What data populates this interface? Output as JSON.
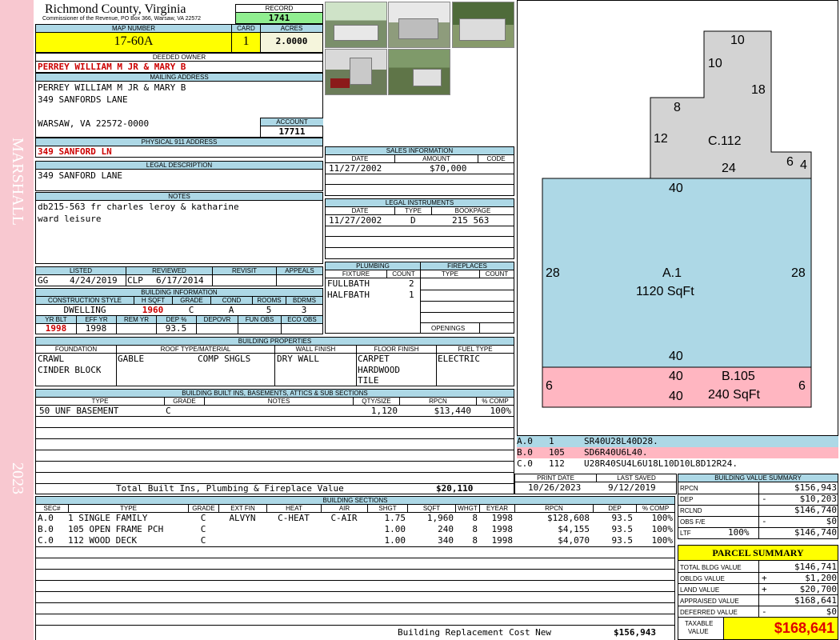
{
  "sidebar": {
    "name": "MARSHALL",
    "year": "2023"
  },
  "header": {
    "county": "Richmond County, Virginia",
    "subtitle": "Commissioner of the Revenue, PO Box 366, Warsaw, VA 22572",
    "record_label": "RECORD",
    "record": "1741",
    "map_label": "MAP NUMBER",
    "map_number": "17-60A",
    "card_label": "CARD",
    "card": "1",
    "acres_label": "ACRES",
    "acres": "2.0000"
  },
  "owner": {
    "label": "DEEDED OWNER",
    "name": "PERREY WILLIAM M JR & MARY B"
  },
  "mailing": {
    "label": "MAILING ADDRESS",
    "line1": "PERREY WILLIAM M JR & MARY B",
    "line2": "349 SANFORDS LANE",
    "line3": "WARSAW, VA 22572-0000",
    "account_label": "ACCOUNT",
    "account": "17711"
  },
  "physical": {
    "label": "PHYSICAL 911 ADDRESS",
    "address": "349 SANFORD LN"
  },
  "legal": {
    "label": "LEGAL DESCRIPTION",
    "text": "349 SANFORD LANE"
  },
  "notes": {
    "label": "NOTES",
    "line1": "db215-563 fr charles leroy & katharine",
    "line2": "ward leisure"
  },
  "status": {
    "listed_label": "LISTED",
    "reviewed_label": "REVIEWED",
    "revisit_label": "REVISIT",
    "appeals_label": "APPEALS",
    "listed_by": "GG",
    "listed_date": "4/24/2019",
    "reviewed_by": "CLP",
    "reviewed_date": "6/17/2014"
  },
  "building_info": {
    "label": "BUILDING INFORMATION",
    "h": [
      "CONSTRUCTION STYLE",
      "H SQFT",
      "GRADE",
      "COND",
      "ROOMS",
      "BDRMS"
    ],
    "v": [
      "DWELLING",
      "1960",
      "C",
      "A",
      "5",
      "3"
    ],
    "h2": [
      "YR BLT",
      "EFF YR",
      "REM YR",
      "DEP %",
      "DEPOVR",
      "FUN OBS",
      "ECO OBS"
    ],
    "v2": [
      "1998",
      "1998",
      "",
      "93.5",
      "",
      "",
      ""
    ]
  },
  "sales": {
    "label": "SALES INFORMATION",
    "h": [
      "DATE",
      "AMOUNT",
      "CODE"
    ],
    "date": "11/27/2002",
    "amount": "$70,000"
  },
  "instruments": {
    "label": "LEGAL INSTRUMENTS",
    "h": [
      "DATE",
      "TYPE",
      "BOOKPAGE"
    ],
    "date": "11/27/2002",
    "type": "D",
    "bookpage": "215 563"
  },
  "plumbing": {
    "label": "PLUMBING",
    "h": [
      "FIXTURE",
      "COUNT"
    ],
    "rows": [
      {
        "f": "FULLBATH",
        "c": "2"
      },
      {
        "f": "HALFBATH",
        "c": "1"
      }
    ]
  },
  "fireplaces": {
    "label": "FIREPLACES",
    "h": [
      "TYPE",
      "COUNT"
    ],
    "openings": "OPENINGS"
  },
  "properties": {
    "label": "BUILDING PROPERTIES",
    "h": [
      "FOUNDATION",
      "ROOF TYPE/MATERIAL",
      "WALL FINISH",
      "FLOOR FINISH",
      "FUEL TYPE"
    ],
    "foundation1": "CRAWL",
    "foundation2": "CINDER BLOCK",
    "roof_type": "GABLE",
    "roof_mat": "COMP SHGLS",
    "wall": "DRY WALL",
    "floor1": "CARPET",
    "floor2": "HARDWOOD",
    "floor3": "TILE",
    "fuel": "ELECTRIC"
  },
  "builtins": {
    "label": "BUILDING BUILT INS, BASEMENTS, ATTICS & SUB SECTIONS",
    "h": [
      "TYPE",
      "GRADE",
      "NOTES",
      "QTY/SIZE",
      "RPCN",
      "% COMP"
    ],
    "row": {
      "type": "50 UNF BASEMENT",
      "grade": "C",
      "qty": "1,120",
      "rpcn": "$13,440",
      "comp": "100%"
    },
    "total_label": "Total Built Ins, Plumbing & Fireplace Value",
    "total": "$20,110"
  },
  "dates": {
    "print_label": "PRINT DATE",
    "print": "10/26/2023",
    "saved_label": "LAST SAVED",
    "saved": "9/12/2019"
  },
  "sections": {
    "label": "BUILDING SECTIONS",
    "h": [
      "SEC#",
      "TYPE",
      "GRADE",
      "EXT FIN",
      "HEAT",
      "AIR",
      "SHGT",
      "SQFT",
      "WHGT",
      "EYEAR",
      "RPCN",
      "DEP",
      "% COMP"
    ],
    "rows": [
      [
        "A.0",
        "1 SINGLE FAMILY",
        "C",
        "ALVYN",
        "C-HEAT",
        "C-AIR",
        "1.75",
        "1,960",
        "8",
        "1998",
        "$128,608",
        "93.5",
        "100%"
      ],
      [
        "B.0",
        "105 OPEN FRAME PCH",
        "C",
        "",
        "",
        "",
        "1.00",
        "240",
        "8",
        "1998",
        "$4,155",
        "93.5",
        "100%"
      ],
      [
        "C.0",
        "112 WOOD DECK",
        "C",
        "",
        "",
        "",
        "1.00",
        "340",
        "8",
        "1998",
        "$4,070",
        "93.5",
        "100%"
      ]
    ],
    "total_label": "Building Replacement Cost New",
    "total": "$156,943"
  },
  "sketch": {
    "c_label": "C.112",
    "a_label": "A.1",
    "a_area": "1120 SqFt",
    "b_label": "B.105",
    "b_area": "240 SqFt",
    "dims": {
      "c_top": "10",
      "c_step_v": "10",
      "c_right": "18",
      "c_step_h": "8",
      "c_left": "12",
      "c_bottom": "24",
      "c_small1": "6",
      "c_small2": "4",
      "a_top": "40",
      "a_left": "28",
      "a_right": "28",
      "a_bottom": "40",
      "b_top": "40",
      "b_bottom": "40",
      "b_left": "6",
      "b_right": "6"
    },
    "colors": {
      "c": "#d3d3d3",
      "a": "#add8e6",
      "b": "#ffb6c1"
    }
  },
  "vectors": [
    {
      "id": "A.0",
      "n": "1",
      "code": "SR40U28L40D28.",
      "color": "#add8e6"
    },
    {
      "id": "B.0",
      "n": "105",
      "code": "SD6R40U6L40.",
      "color": "#ffb6c1"
    },
    {
      "id": "C.0",
      "n": "112",
      "code": "U28R40SU4L6U18L10D10L8D12R24.",
      "color": "#ffffff"
    }
  ],
  "value_summary": {
    "label": "BUILDING VALUE SUMMARY",
    "rows": [
      {
        "k": "RPCN",
        "s": "",
        "v": "$156,943"
      },
      {
        "k": "DEP",
        "s": "-",
        "v": "$10,203"
      },
      {
        "k": "RCLND",
        "s": "",
        "v": "$146,740"
      },
      {
        "k": "OBS F/E",
        "s": "-",
        "v": "$0"
      },
      {
        "k": "LTF",
        "s": "100%",
        "v": "$146,740"
      }
    ]
  },
  "parcel": {
    "label": "PARCEL SUMMARY",
    "rows": [
      {
        "k": "TOTAL BLDG VALUE",
        "s": "",
        "v": "$146,741"
      },
      {
        "k": "OBLDG VALUE",
        "s": "+",
        "v": "$1,200"
      },
      {
        "k": "LAND VALUE",
        "s": "+",
        "v": "$20,700"
      },
      {
        "k": "APPRAISED VALUE",
        "s": "",
        "v": "$168,641"
      },
      {
        "k": "DEFERRED VALUE",
        "s": "-",
        "v": "$0"
      }
    ],
    "taxable_label1": "TAXABLE",
    "taxable_label2": "VALUE",
    "taxable": "$168,641"
  }
}
